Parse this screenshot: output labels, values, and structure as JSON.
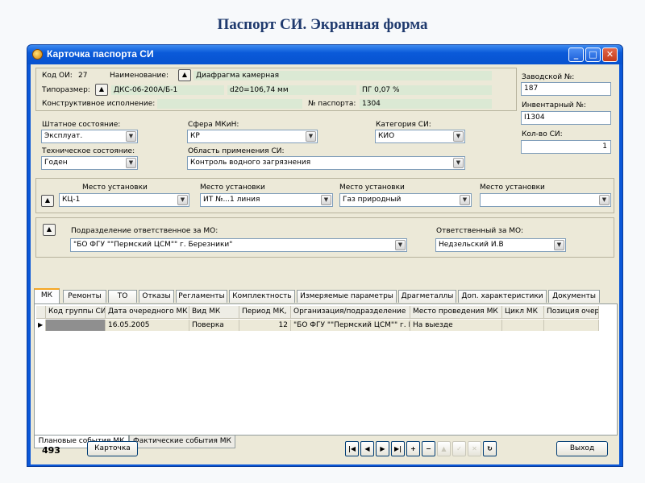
{
  "slide_title": "Паспорт СИ. Экранная форма",
  "window": {
    "title": "Карточка паспорта СИ",
    "minimize": "_",
    "maximize": "□",
    "close": "✕"
  },
  "header": {
    "kod_label": "Код ОИ:",
    "kod_value": "27",
    "naim_label": "Наименование:",
    "naim_value": "Диафрагма камерная",
    "tipo_label": "Типоразмер:",
    "tipo_value": "ДКС-06-200А/Б-1",
    "d20_value": "d20=106,74 мм",
    "pg_value": "ПГ 0,07 %",
    "konstr_label": "Конструктивное исполнение:",
    "konstr_value": "",
    "passport_label": "№ паспорта:",
    "passport_value": "1304",
    "zavod_label": "Заводской №:",
    "zavod_value": "187",
    "invent_label": "Инвентарный №:",
    "invent_value": "I1304",
    "kol_label": "Кол-во СИ:",
    "kol_value": "1"
  },
  "state": {
    "shtat_label": "Штатное состояние:",
    "shtat_value": "Эксплуат.",
    "sfera_label": "Сфера МКиН:",
    "sfera_value": "КР",
    "kategoria_label": "Категория СИ:",
    "kategoria_value": "КИО",
    "tech_label": "Техническое состояние:",
    "tech_value": "Годен",
    "oblast_label": "Область применения СИ:",
    "oblast_value": "Контроль водного загрязнения"
  },
  "location": {
    "label": "Место установки",
    "values": [
      "КЦ-1",
      "ИТ №...1 линия",
      "Газ природный",
      ""
    ]
  },
  "mo": {
    "podr_label": "Подразделение ответственное за МО:",
    "podr_value": "\"БО ФГУ \"\"Пермский ЦСМ\"\" г. Березники\"",
    "resp_label": "Ответственный за МО:",
    "resp_value": "Недзельский И.В"
  },
  "tabs": [
    "МК",
    "Ремонты",
    "ТО",
    "Отказы",
    "Регламенты",
    "Комплектность",
    "Измеряемые параметры",
    "Драгметаллы",
    "Доп. характеристики",
    "Документы"
  ],
  "grid": {
    "columns": [
      "Код группы СИ",
      "Дата очередного МК",
      "Вид МК",
      "Период МК,",
      "Организация/подразделение",
      "Место проведения МК",
      "Цикл МК",
      "Позиция очер."
    ],
    "rows": [
      [
        "",
        "16.05.2005",
        "Поверка",
        "12",
        "\"БО ФГУ \"\"Пермский ЦСМ\"\" г. Бе",
        "На выезде",
        "",
        ""
      ]
    ]
  },
  "bottom_tabs": [
    "Плановые события МК",
    "Фактические события МК"
  ],
  "footer": {
    "count": "493",
    "card_button": "Карточка",
    "exit_button": "Выход"
  }
}
